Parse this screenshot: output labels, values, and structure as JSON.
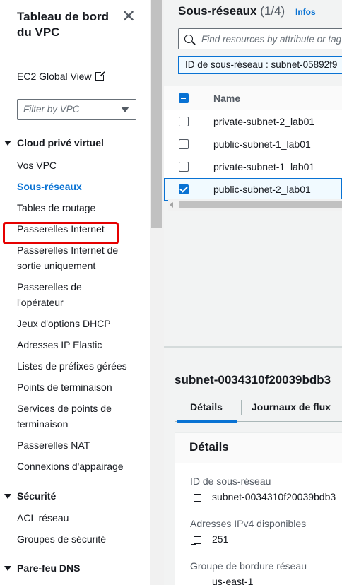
{
  "sidebar": {
    "title": "Tableau de bord du VPC",
    "close_symbol": "✕",
    "global_view_link": "EC2 Global View",
    "filter_placeholder": "Filter by VPC",
    "sections": [
      {
        "label": "Cloud privé virtuel",
        "items": [
          {
            "label": "Vos VPC",
            "active": false
          },
          {
            "label": "Sous-réseaux",
            "active": true
          },
          {
            "label": "Tables de routage",
            "active": false
          },
          {
            "label": "Passerelles Internet",
            "active": false,
            "highlighted": true
          },
          {
            "label": "Passerelles Internet de sortie uniquement",
            "active": false
          },
          {
            "label": "Passerelles de l'opérateur",
            "active": false
          },
          {
            "label": "Jeux d'options DHCP",
            "active": false
          },
          {
            "label": "Adresses IP Elastic",
            "active": false
          },
          {
            "label": "Listes de préfixes gérées",
            "active": false
          },
          {
            "label": "Points de terminaison",
            "active": false
          },
          {
            "label": "Services de points de terminaison",
            "active": false
          },
          {
            "label": "Passerelles NAT",
            "active": false
          },
          {
            "label": "Connexions d'appairage",
            "active": false
          }
        ]
      },
      {
        "label": "Sécurité",
        "items": [
          {
            "label": "ACL réseau",
            "active": false
          },
          {
            "label": "Groupes de sécurité",
            "active": false
          }
        ]
      },
      {
        "label": "Pare-feu DNS",
        "items": []
      }
    ]
  },
  "main": {
    "title": "Sous-réseaux",
    "count": "(1/4)",
    "info_link": "Infos",
    "search_placeholder": "Find resources by attribute or tag",
    "filter_token": "ID de sous-réseau : subnet-05892f9",
    "table": {
      "column_name": "Name",
      "rows": [
        {
          "name": "private-subnet-2_lab01",
          "checked": false
        },
        {
          "name": "public-subnet-1_lab01",
          "checked": false
        },
        {
          "name": "private-subnet-1_lab01",
          "checked": false
        },
        {
          "name": "public-subnet-2_lab01",
          "checked": true
        }
      ]
    }
  },
  "details": {
    "title": "subnet-0034310f20039bdb3",
    "tabs": [
      "Détails",
      "Journaux de flux"
    ],
    "panel_title": "Détails",
    "fields": [
      {
        "label": "ID de sous-réseau",
        "value": "subnet-0034310f20039bdb3"
      },
      {
        "label": "Adresses IPv4 disponibles",
        "value": "251"
      },
      {
        "label": "Groupe de bordure réseau",
        "value": "us-east-1"
      }
    ]
  },
  "colors": {
    "accent": "#0972d3",
    "highlight": "#e60000",
    "text": "#16191f"
  }
}
